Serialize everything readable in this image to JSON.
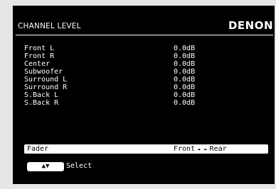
{
  "header": {
    "title": "CHANNEL LEVEL",
    "brand": "DENON"
  },
  "channels": [
    {
      "label": "Front L",
      "value": "0.0dB"
    },
    {
      "label": "Front R",
      "value": "0.0dB"
    },
    {
      "label": "Center",
      "value": "0.0dB"
    },
    {
      "label": "Subwoofer",
      "value": "0.0dB"
    },
    {
      "label": "Surround L",
      "value": "0.0dB"
    },
    {
      "label": "Surround R",
      "value": "0.0dB"
    },
    {
      "label": "S.Back L",
      "value": "0.0dB"
    },
    {
      "label": "S.Back R",
      "value": "0.0dB"
    }
  ],
  "fader": {
    "label": "Fader",
    "left": "Front",
    "left_arrow": "◄",
    "right_arrow": "►",
    "right": "Rear"
  },
  "footer": {
    "key_icon": "▲▼",
    "label": "Select"
  }
}
